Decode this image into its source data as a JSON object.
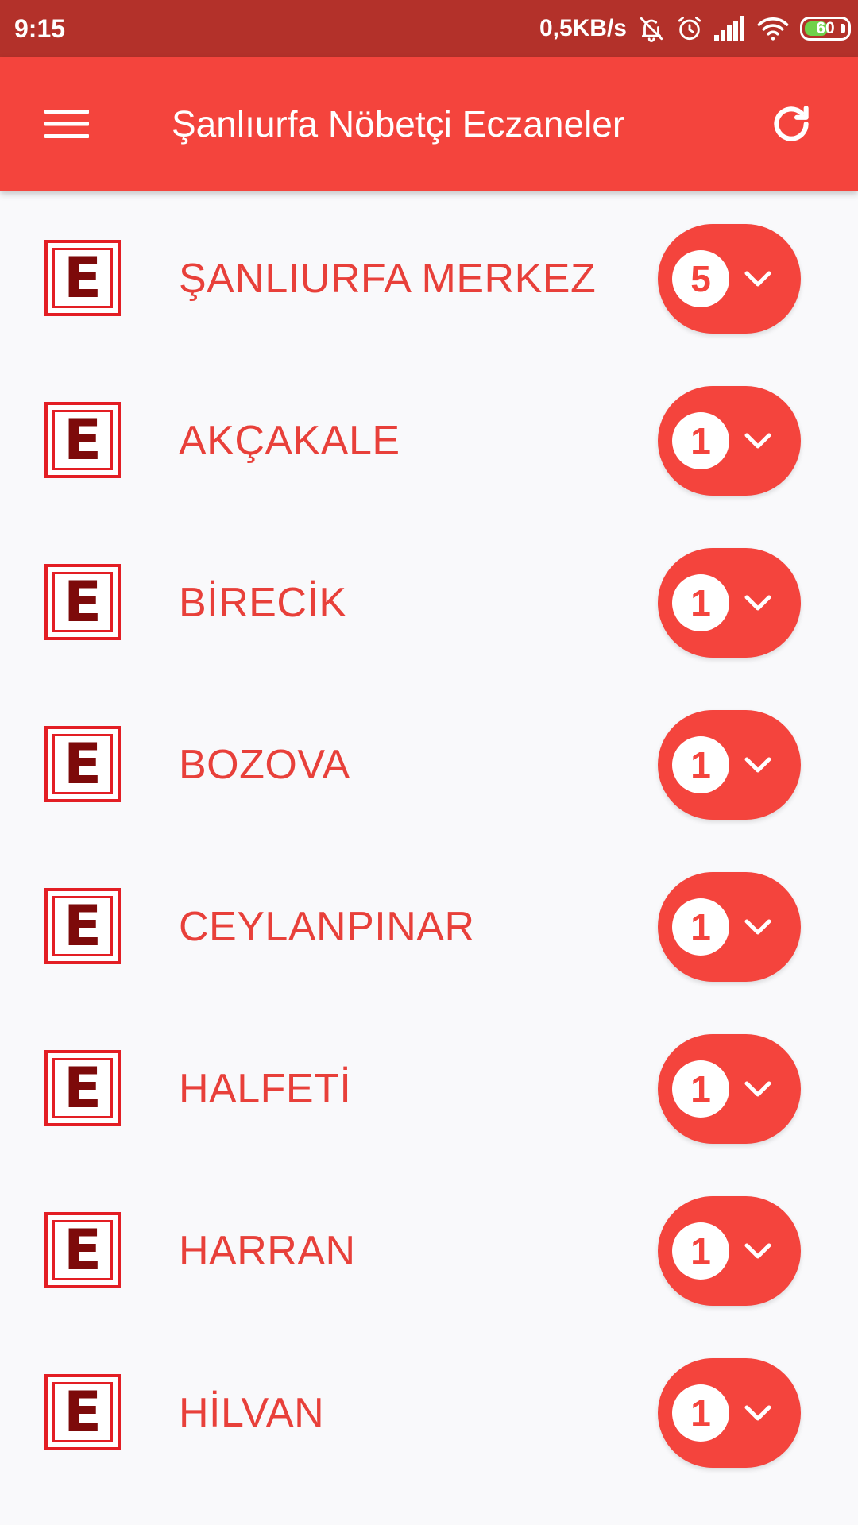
{
  "status_bar": {
    "time": "9:15",
    "net_speed": "0,5KB/s",
    "battery_level": "60",
    "battery_fraction": 0.6,
    "icons": [
      "mute-notifications-icon",
      "alarm-icon",
      "signal-icon",
      "wifi-icon",
      "battery-icon"
    ]
  },
  "app_bar": {
    "title": "Şanlıurfa Nöbetçi Eczaneler",
    "menu_icon": "hamburger-menu-icon",
    "refresh_icon": "refresh-icon"
  },
  "logo_letter": "E",
  "districts": [
    {
      "name": "ŞANLIURFA MERKEZ",
      "count": "5"
    },
    {
      "name": "AKÇAKALE",
      "count": "1"
    },
    {
      "name": "BİRECİK",
      "count": "1"
    },
    {
      "name": "BOZOVA",
      "count": "1"
    },
    {
      "name": "CEYLANPINAR",
      "count": "1"
    },
    {
      "name": "HALFETİ",
      "count": "1"
    },
    {
      "name": "HARRAN",
      "count": "1"
    },
    {
      "name": "HİLVAN",
      "count": "1"
    }
  ],
  "colors": {
    "status_bar": "#b3312a",
    "app_bar": "#f4443d",
    "accent_text": "#e8403a",
    "logo_red": "#e31e24",
    "logo_letter": "#7d0a0a",
    "background": "#f9f9fb"
  }
}
